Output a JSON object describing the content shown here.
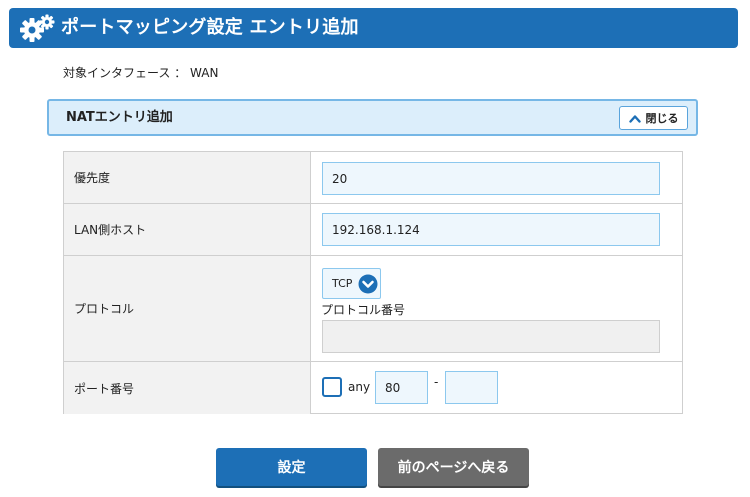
{
  "header": {
    "title": "ポートマッピング設定 エントリ追加",
    "icon": "gear-icon"
  },
  "interface_text": "対象インタフェース ： WAN",
  "section": {
    "title": "NATエントリ追加",
    "close_label": "閉じる"
  },
  "form": {
    "priority": {
      "label": "優先度",
      "value": "20"
    },
    "lan_host": {
      "label": "LAN側ホスト",
      "value": "192.168.1.124"
    },
    "protocol": {
      "label": "プロトコル",
      "selected": "TCP",
      "number_label": "プロトコル番号",
      "number_value": ""
    },
    "port": {
      "label": "ポート番号",
      "any_label": "any",
      "any_checked": false,
      "from_value": "80",
      "separator": "-",
      "to_value": ""
    }
  },
  "buttons": {
    "submit": "設定",
    "back": "前のページへ戻る"
  },
  "colors": {
    "primary": "#1d6fb6",
    "section_bg": "#dceefb",
    "input_bg": "#eef7fd",
    "secondary": "#6b6b6b"
  }
}
